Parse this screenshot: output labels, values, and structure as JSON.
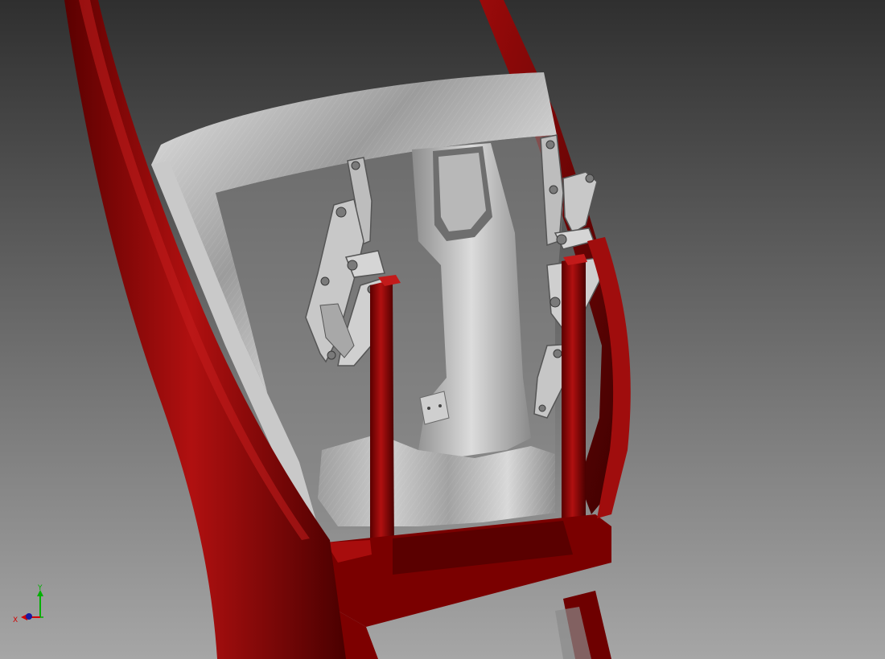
{
  "viewport": {
    "background_top": "#2f2f2f",
    "background_bottom": "#a6a6a6",
    "frame_color": "#8a0000",
    "frame_dark": "#4a0000",
    "frame_highlight": "#c21a1a",
    "metal_light": "#d8d8d8",
    "metal_mid": "#a9a9a9",
    "metal_dark": "#5e5e5e"
  },
  "view_triad": {
    "x_label": "X",
    "y_label": "Y",
    "z_label": "Z",
    "x_color": "#d40000",
    "y_color": "#00b000",
    "z_color": "#1a1aa0"
  }
}
